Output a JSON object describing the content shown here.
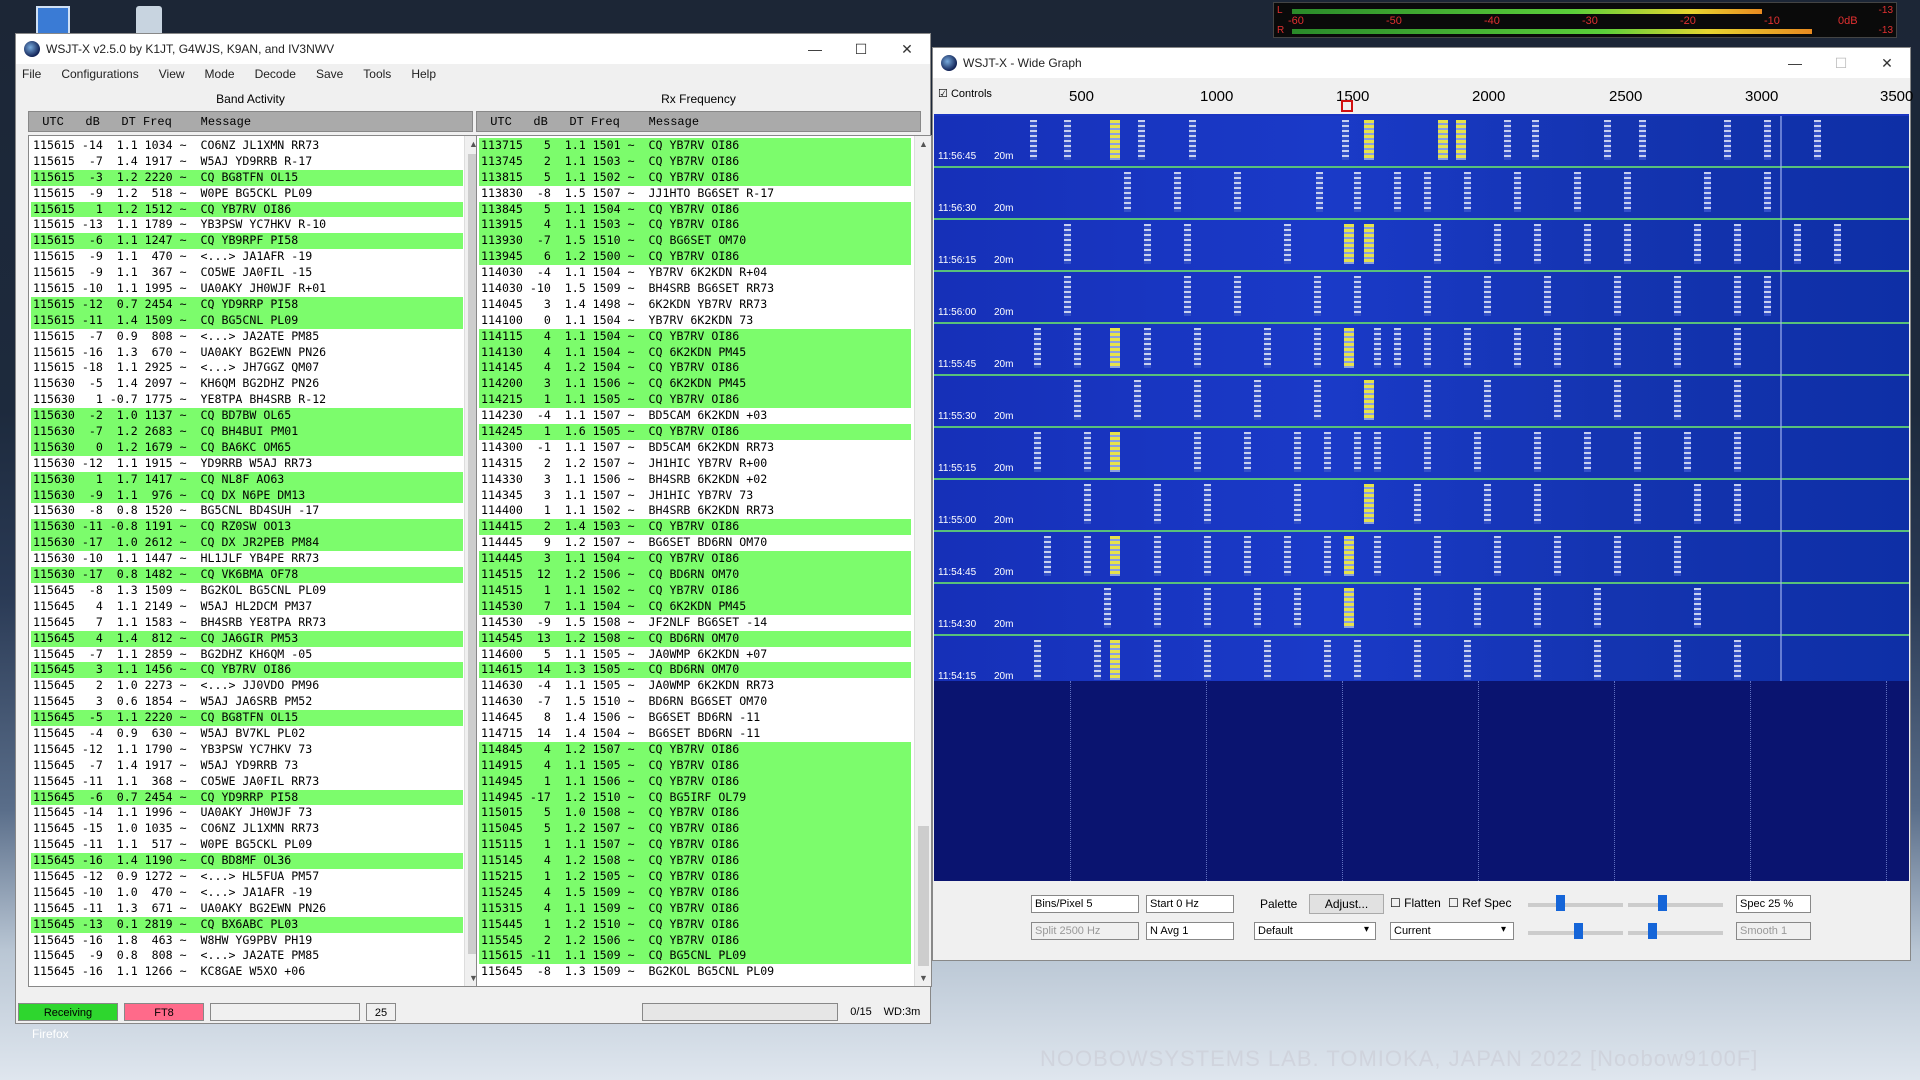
{
  "desktop": {
    "footer": "NOOBOWSYSTEMS LAB. TOMIOKA, JAPAN 2022 [Noobow9100F]",
    "taskbar_label": "Firefox"
  },
  "meter": {
    "scale": [
      "-60",
      "-50",
      "-40",
      "-30",
      "-20",
      "-10",
      "0dB"
    ],
    "right_top": "-13",
    "right_bottom": "-13",
    "left_top": "L",
    "left_bottom": "R"
  },
  "main": {
    "title": "WSJT-X   v2.5.0   by K1JT, G4WJS, K9AN, and IV3NWV",
    "menu": [
      "File",
      "Configurations",
      "View",
      "Mode",
      "Decode",
      "Save",
      "Tools",
      "Help"
    ],
    "band_label": "Band Activity",
    "rx_label": "Rx Frequency",
    "header": " UTC   dB   DT Freq    Message",
    "band_rows": [
      {
        "t": "115615 -14  1.1 1034 ~  CO6NZ JL1XMN RR73",
        "g": false
      },
      {
        "t": "115615  -7  1.4 1917 ~  W5AJ YD9RRB R-17",
        "g": false
      },
      {
        "t": "115615  -3  1.2 2220 ~  CQ BG8TFN OL15",
        "g": true
      },
      {
        "t": "115615  -9  1.2  518 ~  W0PE BG5CKL PL09",
        "g": false
      },
      {
        "t": "115615   1  1.2 1512 ~  CQ YB7RV OI86",
        "g": true
      },
      {
        "t": "115615 -13  1.1 1789 ~  YB3PSW YC7HKV R-10",
        "g": false
      },
      {
        "t": "115615  -6  1.1 1247 ~  CQ YB9RPF PI58",
        "g": true
      },
      {
        "t": "115615  -9  1.1  470 ~  <...> JA1AFR -19",
        "g": false
      },
      {
        "t": "115615  -9  1.1  367 ~  CO5WE JA0FIL -15",
        "g": false
      },
      {
        "t": "115615 -10  1.1 1995 ~  UA0AKY JH0WJF R+01",
        "g": false
      },
      {
        "t": "115615 -12  0.7 2454 ~  CQ YD9RRP PI58",
        "g": true
      },
      {
        "t": "115615 -11  1.4 1509 ~  CQ BG5CNL PL09",
        "g": true
      },
      {
        "t": "115615  -7  0.9  808 ~  <...> JA2ATE PM85",
        "g": false
      },
      {
        "t": "115615 -16  1.3  670 ~  UA0AKY BG2EWN PN26",
        "g": false
      },
      {
        "t": "115615 -18  1.1 2925 ~  <...> JH7GGZ QM07",
        "g": false
      },
      {
        "t": "115630  -5  1.4 2097 ~  KH6QM BG2DHZ PN26",
        "g": false
      },
      {
        "t": "115630   1 -0.7 1775 ~  YE8TPA BH4SRB R-12",
        "g": false
      },
      {
        "t": "115630  -2  1.0 1137 ~  CQ BD7BW OL65",
        "g": true
      },
      {
        "t": "115630  -7  1.2 2683 ~  CQ BH4BUI PM01",
        "g": true
      },
      {
        "t": "115630   0  1.2 1679 ~  CQ BA6KC OM65",
        "g": true
      },
      {
        "t": "115630 -12  1.1 1915 ~  YD9RRB W5AJ RR73",
        "g": false
      },
      {
        "t": "115630   1  1.7 1417 ~  CQ NL8F AO63",
        "g": true
      },
      {
        "t": "115630  -9  1.1  976 ~  CQ DX N6PE DM13",
        "g": true
      },
      {
        "t": "115630  -8  0.8 1520 ~  BG5CNL BD4SUH -17",
        "g": false
      },
      {
        "t": "115630 -11 -0.8 1191 ~  CQ RZ0SW OO13",
        "g": true
      },
      {
        "t": "115630 -17  1.0 2612 ~  CQ DX JR2PEB PM84",
        "g": true
      },
      {
        "t": "115630 -10  1.1 1447 ~  HL1JLF YB4PE RR73",
        "g": false
      },
      {
        "t": "115630 -17  0.8 1482 ~  CQ VK6BMA OF78",
        "g": true
      },
      {
        "t": "115645  -8  1.3 1509 ~  BG2KOL BG5CNL PL09",
        "g": false
      },
      {
        "t": "115645   4  1.1 2149 ~  W5AJ HL2DCM PM37",
        "g": false
      },
      {
        "t": "115645   7  1.1 1583 ~  BH4SRB YE8TPA RR73",
        "g": false
      },
      {
        "t": "115645   4  1.4  812 ~  CQ JA6GIR PM53",
        "g": true
      },
      {
        "t": "115645  -7  1.1 2859 ~  BG2DHZ KH6QM -05",
        "g": false
      },
      {
        "t": "115645   3  1.1 1456 ~  CQ YB7RV OI86",
        "g": true
      },
      {
        "t": "115645   2  1.0 2273 ~  <...> JJ0VDO PM96",
        "g": false
      },
      {
        "t": "115645   3  0.6 1854 ~  W5AJ JA6SRB PM52",
        "g": false
      },
      {
        "t": "115645  -5  1.1 2220 ~  CQ BG8TFN OL15",
        "g": true
      },
      {
        "t": "115645  -4  0.9  630 ~  W5AJ BV7KL PL02",
        "g": false
      },
      {
        "t": "115645 -12  1.1 1790 ~  YB3PSW YC7HKV 73",
        "g": false
      },
      {
        "t": "115645  -7  1.4 1917 ~  W5AJ YD9RRB 73",
        "g": false
      },
      {
        "t": "115645 -11  1.1  368 ~  CO5WE JA0FIL RR73",
        "g": false
      },
      {
        "t": "115645  -6  0.7 2454 ~  CQ YD9RRP PI58",
        "g": true
      },
      {
        "t": "115645 -14  1.1 1996 ~  UA0AKY JH0WJF 73",
        "g": false
      },
      {
        "t": "115645 -15  1.0 1035 ~  CO6NZ JL1XMN RR73",
        "g": false
      },
      {
        "t": "115645 -11  1.1  517 ~  W0PE BG5CKL PL09",
        "g": false
      },
      {
        "t": "115645 -16  1.4 1190 ~  CQ BD8MF OL36",
        "g": true
      },
      {
        "t": "115645 -12  0.9 1272 ~  <...> HL5FUA PM57",
        "g": false
      },
      {
        "t": "115645 -10  1.0  470 ~  <...> JA1AFR -19",
        "g": false
      },
      {
        "t": "115645 -11  1.3  671 ~  UA0AKY BG2EWN PN26",
        "g": false
      },
      {
        "t": "115645 -13  0.1 2819 ~  CQ BX6ABC PL03",
        "g": true
      },
      {
        "t": "115645 -16  1.8  463 ~  W8HW YG9PBV PH19",
        "g": false
      },
      {
        "t": "115645  -9  0.8  808 ~  <...> JA2ATE PM85",
        "g": false
      },
      {
        "t": "115645 -16  1.1 1266 ~  KC8GAE W5XO +06",
        "g": false
      }
    ],
    "rx_rows": [
      {
        "t": "113715   5  1.1 1501 ~  CQ YB7RV OI86",
        "g": true
      },
      {
        "t": "113745   2  1.1 1503 ~  CQ YB7RV OI86",
        "g": true
      },
      {
        "t": "113815   5  1.1 1502 ~  CQ YB7RV OI86",
        "g": true
      },
      {
        "t": "113830  -8  1.5 1507 ~  JJ1HTO BG6SET R-17",
        "g": false
      },
      {
        "t": "113845   5  1.1 1504 ~  CQ YB7RV OI86",
        "g": true
      },
      {
        "t": "113915   4  1.1 1503 ~  CQ YB7RV OI86",
        "g": true
      },
      {
        "t": "113930  -7  1.5 1510 ~  CQ BG6SET OM70",
        "g": true
      },
      {
        "t": "113945   6  1.2 1500 ~  CQ YB7RV OI86",
        "g": true
      },
      {
        "t": "114030  -4  1.1 1504 ~  YB7RV 6K2KDN R+04",
        "g": false
      },
      {
        "t": "114030 -10  1.5 1509 ~  BH4SRB BG6SET RR73",
        "g": false
      },
      {
        "t": "114045   3  1.4 1498 ~  6K2KDN YB7RV RR73",
        "g": false
      },
      {
        "t": "114100   0  1.1 1504 ~  YB7RV 6K2KDN 73",
        "g": false
      },
      {
        "t": "114115   4  1.1 1504 ~  CQ YB7RV OI86",
        "g": true
      },
      {
        "t": "114130   4  1.1 1504 ~  CQ 6K2KDN PM45",
        "g": true
      },
      {
        "t": "114145   4  1.2 1504 ~  CQ YB7RV OI86",
        "g": true
      },
      {
        "t": "114200   3  1.1 1506 ~  CQ 6K2KDN PM45",
        "g": true
      },
      {
        "t": "114215   1  1.1 1505 ~  CQ YB7RV OI86",
        "g": true
      },
      {
        "t": "114230  -4  1.1 1507 ~  BD5CAM 6K2KDN +03",
        "g": false
      },
      {
        "t": "114245   1  1.6 1505 ~  CQ YB7RV OI86",
        "g": true
      },
      {
        "t": "114300  -1  1.1 1507 ~  BD5CAM 6K2KDN RR73",
        "g": false
      },
      {
        "t": "114315   2  1.2 1507 ~  JH1HIC YB7RV R+00",
        "g": false
      },
      {
        "t": "114330   3  1.1 1506 ~  BH4SRB 6K2KDN +02",
        "g": false
      },
      {
        "t": "114345   3  1.1 1507 ~  JH1HIC YB7RV 73",
        "g": false
      },
      {
        "t": "114400   1  1.1 1502 ~  BH4SRB 6K2KDN RR73",
        "g": false
      },
      {
        "t": "114415   2  1.4 1503 ~  CQ YB7RV OI86",
        "g": true
      },
      {
        "t": "114445   9  1.2 1507 ~  BG6SET BD6RN OM70",
        "g": false
      },
      {
        "t": "114445   3  1.1 1504 ~  CQ YB7RV OI86",
        "g": true
      },
      {
        "t": "114515  12  1.2 1506 ~  CQ BD6RN OM70",
        "g": true
      },
      {
        "t": "114515   1  1.1 1502 ~  CQ YB7RV OI86",
        "g": true
      },
      {
        "t": "114530   7  1.1 1504 ~  CQ 6K2KDN PM45",
        "g": true
      },
      {
        "t": "114530  -9  1.5 1508 ~  JF2NLF BG6SET -14",
        "g": false
      },
      {
        "t": "114545  13  1.2 1508 ~  CQ BD6RN OM70",
        "g": true
      },
      {
        "t": "114600   5  1.1 1505 ~  JA0WMP 6K2KDN +07",
        "g": false
      },
      {
        "t": "114615  14  1.3 1505 ~  CQ BD6RN OM70",
        "g": true
      },
      {
        "t": "114630  -4  1.1 1505 ~  JA0WMP 6K2KDN RR73",
        "g": false
      },
      {
        "t": "114630  -7  1.5 1510 ~  BD6RN BG6SET OM70",
        "g": false
      },
      {
        "t": "114645   8  1.4 1506 ~  BG6SET BD6RN -11",
        "g": false
      },
      {
        "t": "114715  14  1.4 1504 ~  BG6SET BD6RN -11",
        "g": false
      },
      {
        "t": "114845   4  1.2 1507 ~  CQ YB7RV OI86",
        "g": true
      },
      {
        "t": "114915   4  1.1 1505 ~  CQ YB7RV OI86",
        "g": true
      },
      {
        "t": "114945   1  1.1 1506 ~  CQ YB7RV OI86",
        "g": true
      },
      {
        "t": "114945 -17  1.2 1510 ~  CQ BG5IRF OL79",
        "g": true
      },
      {
        "t": "115015   5  1.0 1508 ~  CQ YB7RV OI86",
        "g": true
      },
      {
        "t": "115045   5  1.2 1507 ~  CQ YB7RV OI86",
        "g": true
      },
      {
        "t": "115115   1  1.1 1507 ~  CQ YB7RV OI86",
        "g": true
      },
      {
        "t": "115145   4  1.2 1508 ~  CQ YB7RV OI86",
        "g": true
      },
      {
        "t": "115215   1  1.2 1505 ~  CQ YB7RV OI86",
        "g": true
      },
      {
        "t": "115245   4  1.5 1509 ~  CQ YB7RV OI86",
        "g": true
      },
      {
        "t": "115315   4  1.1 1509 ~  CQ YB7RV OI86",
        "g": true
      },
      {
        "t": "115445   1  1.2 1510 ~  CQ YB7RV OI86",
        "g": true
      },
      {
        "t": "115545   2  1.2 1506 ~  CQ YB7RV OI86",
        "g": true
      },
      {
        "t": "115615 -11  1.1 1509 ~  CQ BG5CNL PL09",
        "g": true
      },
      {
        "t": "115645  -8  1.3 1509 ~  BG2KOL BG5CNL PL09",
        "g": false
      }
    ],
    "status": {
      "receiving": "Receiving",
      "mode": "FT8",
      "count": "25",
      "progress": "0/15",
      "wd": "WD:3m"
    }
  },
  "wide": {
    "title": "WSJT-X - Wide Graph",
    "controls_label": "Controls",
    "scale": [
      "500",
      "1000",
      "1500",
      "2000",
      "2500",
      "3000",
      "3500"
    ],
    "timestamps": [
      "11:56:45",
      "11:56:30",
      "11:56:15",
      "11:56:00",
      "11:55:45",
      "11:55:30",
      "11:55:15",
      "11:55:00",
      "11:54:45",
      "11:54:30",
      "11:54:15"
    ],
    "band": "20m",
    "controls": {
      "bins": "Bins/Pixel  5",
      "start": "Start 0 Hz",
      "palette": "Palette",
      "adjust": "Adjust...",
      "flatten": "Flatten",
      "refspec": "Ref Spec",
      "spec": "Spec 25 %",
      "split": "Split  2500  Hz",
      "navg": "N Avg 1",
      "palette_value": "Default",
      "current": "Current",
      "smooth": "Smooth   1"
    }
  }
}
